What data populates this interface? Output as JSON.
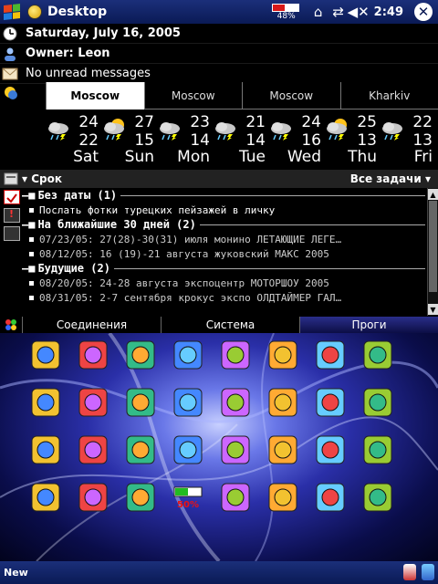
{
  "titlebar": {
    "title": "Desktop",
    "battery_pct": "48%",
    "battery_level": 0.48,
    "time": "2:49"
  },
  "today": {
    "date": "Saturday, July 16, 2005",
    "owner": "Owner: Leon",
    "messages": "No unread messages"
  },
  "weather": {
    "tabs": [
      "Moscow",
      "Moscow",
      "Moscow",
      "Kharkiv"
    ],
    "days": [
      {
        "hi": "24",
        "lo": "22",
        "name": "Sat",
        "icon": "thunderstorm-icon"
      },
      {
        "hi": "27",
        "lo": "15",
        "name": "Sun",
        "icon": "partly-cloudy-storm-icon"
      },
      {
        "hi": "23",
        "lo": "14",
        "name": "Mon",
        "icon": "thunderstorm-icon"
      },
      {
        "hi": "21",
        "lo": "14",
        "name": "Tue",
        "icon": "thunderstorm-icon"
      },
      {
        "hi": "24",
        "lo": "16",
        "name": "Wed",
        "icon": "thunderstorm-icon"
      },
      {
        "hi": "25",
        "lo": "13",
        "name": "Thu",
        "icon": "partly-cloudy-storm-icon"
      },
      {
        "hi": "22",
        "lo": "13",
        "name": "Fri",
        "icon": "thunderstorm-icon"
      }
    ]
  },
  "tasks": {
    "header_left": "Срок",
    "header_right": "Все задачи",
    "lines": [
      {
        "kind": "group",
        "text": "Без даты (1)"
      },
      {
        "kind": "item",
        "text": "Послать фотки турецких пейзажей в личку"
      },
      {
        "kind": "group",
        "text": "На ближайшие 30 дней (2)"
      },
      {
        "kind": "item",
        "text": "07/23/05: 27(28)-30(31) июля монино ЛЕТАЮЩИЕ ЛЕГЕ…"
      },
      {
        "kind": "item",
        "text": "08/12/05: 16 (19)-21 августа жуковский МАКС 2005"
      },
      {
        "kind": "group",
        "text": "Будущие (2)"
      },
      {
        "kind": "item",
        "text": "08/20/05: 24-28 августа экспоцентр МОТОРШОУ 2005"
      },
      {
        "kind": "item",
        "text": "08/31/05: 2-7 сентября крокус экспо ОЛДТАЙМЕР ГАЛ…"
      }
    ]
  },
  "quick_tabs": [
    "Соединения",
    "Система",
    "Проги"
  ],
  "icons": [
    "folder-search-icon",
    "beta-icon",
    "tv-icon",
    "film-icon",
    "moon-icon",
    "tree-icon",
    "photo-icon",
    "sync-icon",
    "camera-icon",
    "flash-icon",
    "magnifier-icon",
    "globe-grid-icon",
    "satellite-dish-icon",
    "globe-icon",
    "hr-icon",
    "archive-icon",
    "pdf-icon",
    "ez-icon",
    "books-icon",
    "metro-icon",
    "headphones-icon",
    "phone-icon",
    "sk-icon",
    "recycle-icon",
    "frog-icon",
    "target-icon",
    "vga-icon",
    "battery-meter-icon",
    "gear-icon",
    "radiation-icon",
    "dice-icon",
    "molecule-icon"
  ],
  "battery_meter_label": "50%",
  "bottom": {
    "new_label": "New"
  }
}
